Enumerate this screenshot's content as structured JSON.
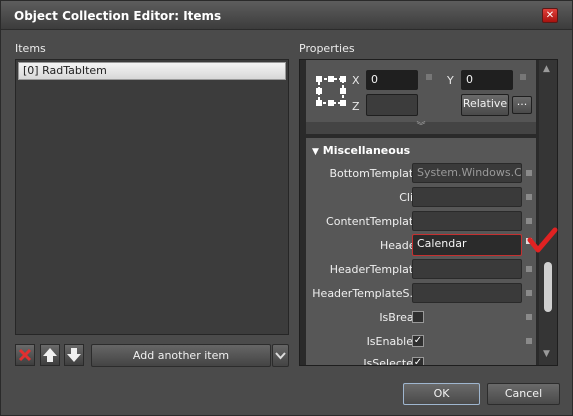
{
  "window": {
    "title": "Object Collection Editor: Items"
  },
  "items_panel": {
    "label": "Items",
    "items": [
      "[0] RadTabItem"
    ],
    "add_button_label": "Add another item"
  },
  "properties_panel": {
    "label": "Properties",
    "position": {
      "x_label": "X",
      "x_value": "0",
      "y_label": "Y",
      "y_value": "0",
      "z_label": "Z",
      "z_value": "",
      "relative_button": "Relative",
      "more_button": "···"
    },
    "section_title": "Miscellaneous",
    "rows": [
      {
        "name": "BottomTemplate",
        "value": "System.Windows.C..."
      },
      {
        "name": "Clip",
        "value": ""
      },
      {
        "name": "ContentTemplate",
        "value": ""
      },
      {
        "name": "Header",
        "value": "Calendar"
      },
      {
        "name": "HeaderTemplate",
        "value": ""
      },
      {
        "name": "HeaderTemplateS...",
        "value": ""
      },
      {
        "name": "IsBreak",
        "checked": false
      },
      {
        "name": "IsEnabled",
        "checked": true
      },
      {
        "name": "IsSelected",
        "checked": true
      }
    ]
  },
  "footer": {
    "ok_label": "OK",
    "cancel_label": "Cancel"
  },
  "colors": {
    "background": "#4b4b4b",
    "accent_red": "#d42a2a",
    "field_bg": "#3a3a3a"
  }
}
